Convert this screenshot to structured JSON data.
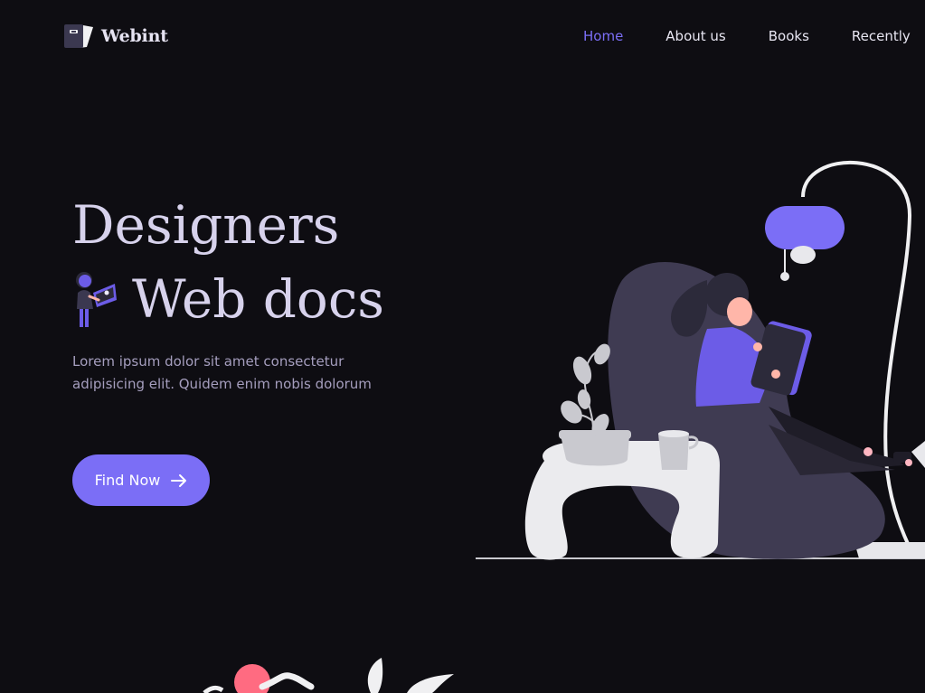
{
  "brand": {
    "name": "Webint",
    "icon": "book-logo-icon"
  },
  "nav": {
    "items": [
      {
        "label": "Home",
        "active": true
      },
      {
        "label": "About us",
        "active": false
      },
      {
        "label": "Books",
        "active": false
      },
      {
        "label": "Recently",
        "active": false
      }
    ]
  },
  "hero": {
    "title_line1": "Designers",
    "title_line2": "Web docs",
    "description": "Lorem ipsum dolor sit amet consectetur adipisicing elit. Quidem enim nobis dolorum",
    "cta_label": "Find Now",
    "cta_icon": "arrow-right-icon",
    "figure_icon": "person-reading-icon"
  },
  "illustration": {
    "icon": "woman-reading-on-beanbag-illustration"
  },
  "colors": {
    "background": "#0e0d12",
    "accent": "#7b6ef6",
    "heading": "#d7d2ec",
    "body_text": "#a59ebe",
    "nav_text": "#e8e6f2"
  }
}
